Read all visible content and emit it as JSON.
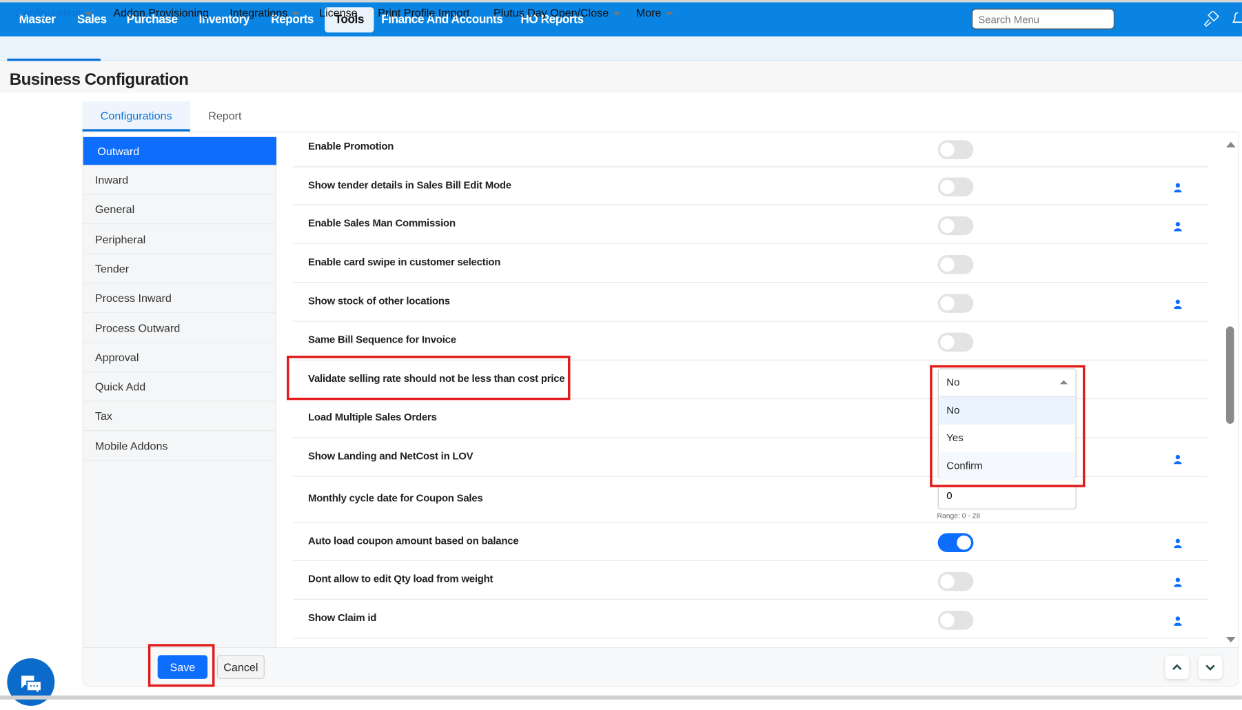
{
  "top_nav": {
    "items": [
      "Master",
      "Sales",
      "Purchase",
      "Inventory",
      "Reports",
      "Tools",
      "Finance And Accounts",
      "HO Reports"
    ],
    "active": "Tools",
    "search_placeholder": "Search Menu",
    "icons": [
      "paintbrush-icon",
      "bell-icon"
    ]
  },
  "sub_nav": {
    "items": [
      {
        "label": "Configuration",
        "dropdown": true
      },
      {
        "label": "Addon Provisioning",
        "dropdown": false
      },
      {
        "label": "Integrations",
        "dropdown": true
      },
      {
        "label": "License",
        "dropdown": false
      },
      {
        "label": "Print Profile Import",
        "dropdown": false
      },
      {
        "label": "Plutus Day Open/Close",
        "dropdown": true
      },
      {
        "label": "More",
        "dropdown": true
      }
    ]
  },
  "page": {
    "title": "Business Configuration"
  },
  "tabs": [
    "Configurations",
    "Report"
  ],
  "side_menu": [
    "Outward",
    "Inward",
    "General",
    "Peripheral",
    "Tender",
    "Process Inward",
    "Process Outward",
    "Approval",
    "Quick Add",
    "Tax",
    "Mobile Addons"
  ],
  "settings": [
    {
      "label": "Enable Promotion",
      "type": "toggle",
      "on": false,
      "user_icon": false
    },
    {
      "label": "Show tender details in Sales Bill Edit Mode",
      "type": "toggle",
      "on": false,
      "user_icon": true
    },
    {
      "label": "Enable Sales Man Commission",
      "type": "toggle",
      "on": false,
      "user_icon": true
    },
    {
      "label": "Enable card swipe in customer selection",
      "type": "toggle",
      "on": false,
      "user_icon": false
    },
    {
      "label": "Show stock of other locations",
      "type": "toggle",
      "on": false,
      "user_icon": true
    },
    {
      "label": "Same Bill Sequence for Invoice",
      "type": "toggle",
      "on": false,
      "user_icon": false
    },
    {
      "label": "Validate selling rate should not be less than cost price",
      "type": "select",
      "user_icon": false
    },
    {
      "label": "Load Multiple Sales Orders",
      "type": "none",
      "user_icon": false
    },
    {
      "label": "Show Landing and NetCost in LOV",
      "type": "none",
      "user_icon": true
    },
    {
      "label": "Monthly cycle date for Coupon Sales",
      "type": "number",
      "user_icon": false
    },
    {
      "label": "Auto load coupon amount based on balance",
      "type": "toggle",
      "on": true,
      "user_icon": true
    },
    {
      "label": "Dont allow to edit Qty load from weight",
      "type": "toggle",
      "on": false,
      "user_icon": true
    },
    {
      "label": "Show Claim id",
      "type": "toggle",
      "on": false,
      "user_icon": true
    }
  ],
  "dropdown": {
    "selected": "No",
    "options": [
      "No",
      "Yes",
      "Confirm"
    ]
  },
  "coupon_input": {
    "value": "0",
    "hint": "Range: 0 - 28"
  },
  "footer": {
    "save": "Save",
    "cancel": "Cancel"
  },
  "colors": {
    "primary": "#0984e3",
    "accent": "#0d6efd",
    "highlight": "#e21b1b"
  }
}
